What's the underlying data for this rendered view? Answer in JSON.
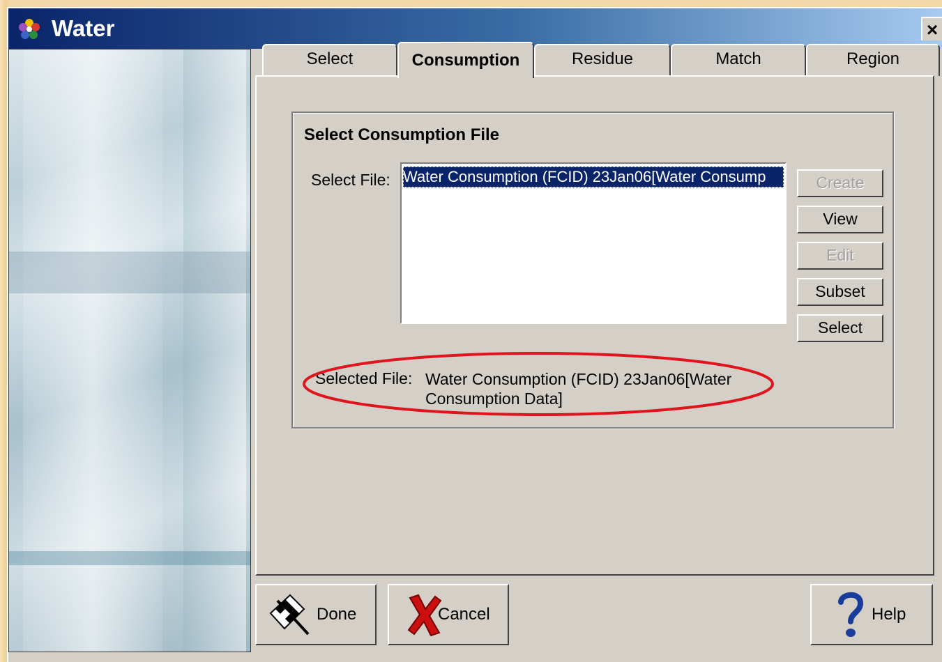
{
  "window": {
    "title": "Water",
    "close_glyph": "×"
  },
  "tabs": [
    {
      "label": "Select",
      "active": false
    },
    {
      "label": "Consumption",
      "active": true
    },
    {
      "label": "Residue",
      "active": false
    },
    {
      "label": "Match",
      "active": false
    },
    {
      "label": "Region",
      "active": false
    }
  ],
  "group": {
    "title": "Select Consumption File",
    "select_file_label": "Select File:",
    "files": [
      "Water Consumption (FCID) 23Jan06[Water Consump"
    ],
    "selected_index": 0
  },
  "side_buttons": [
    {
      "label": "Create",
      "enabled": false
    },
    {
      "label": "View",
      "enabled": true
    },
    {
      "label": "Edit",
      "enabled": false
    },
    {
      "label": "Subset",
      "enabled": true
    },
    {
      "label": "Select",
      "enabled": true
    }
  ],
  "selected_file": {
    "label": "Selected File:",
    "value": "Water Consumption (FCID) 23Jan06[Water Consumption Data]"
  },
  "footer": {
    "done_label": "Done",
    "cancel_label": "Cancel",
    "help_label": "Help"
  },
  "colors": {
    "highlight_ellipse": "#e0141c",
    "selection": "#0a246a",
    "face": "#d4d0c8"
  }
}
